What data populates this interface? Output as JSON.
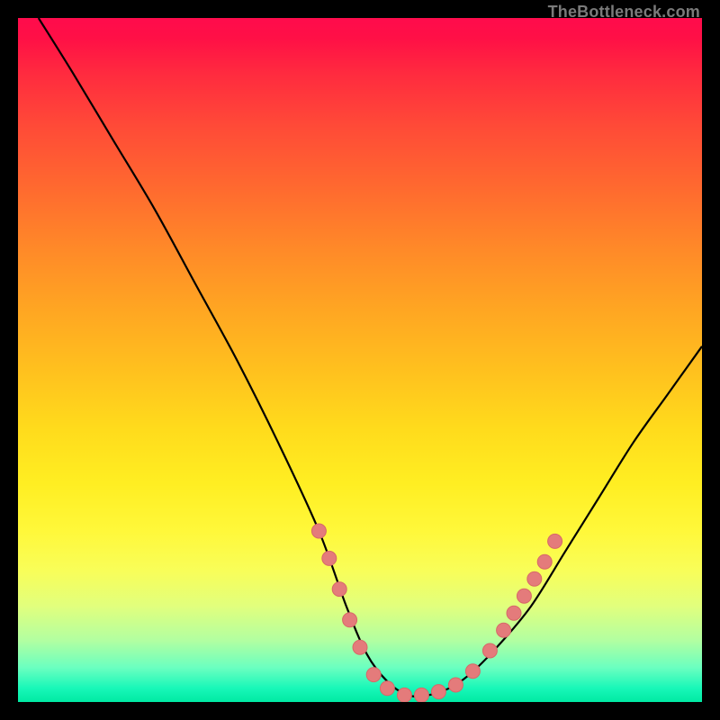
{
  "watermark": "TheBottleneck.com",
  "colors": {
    "frame": "#000000",
    "curve_stroke": "#000000",
    "marker_fill": "#e47b7b",
    "marker_stroke": "#d76868"
  },
  "chart_data": {
    "type": "line",
    "title": "",
    "xlabel": "",
    "ylabel": "",
    "xlim": [
      0,
      100
    ],
    "ylim": [
      0,
      100
    ],
    "grid": false,
    "series": [
      {
        "name": "curve",
        "x": [
          3,
          8,
          14,
          20,
          26,
          32,
          38,
          44,
          48,
          51,
          54,
          57,
          60,
          63,
          66,
          70,
          75,
          80,
          85,
          90,
          95,
          100
        ],
        "y": [
          100,
          92,
          82,
          72,
          61,
          50,
          38,
          25,
          14,
          7,
          3,
          1,
          1,
          2,
          4,
          8,
          14,
          22,
          30,
          38,
          45,
          52
        ]
      }
    ],
    "markers": [
      {
        "x": 44.0,
        "y": 25.0
      },
      {
        "x": 45.5,
        "y": 21.0
      },
      {
        "x": 47.0,
        "y": 16.5
      },
      {
        "x": 48.5,
        "y": 12.0
      },
      {
        "x": 50.0,
        "y": 8.0
      },
      {
        "x": 52.0,
        "y": 4.0
      },
      {
        "x": 54.0,
        "y": 2.0
      },
      {
        "x": 56.5,
        "y": 1.0
      },
      {
        "x": 59.0,
        "y": 1.0
      },
      {
        "x": 61.5,
        "y": 1.5
      },
      {
        "x": 64.0,
        "y": 2.5
      },
      {
        "x": 66.5,
        "y": 4.5
      },
      {
        "x": 69.0,
        "y": 7.5
      },
      {
        "x": 71.0,
        "y": 10.5
      },
      {
        "x": 72.5,
        "y": 13.0
      },
      {
        "x": 74.0,
        "y": 15.5
      },
      {
        "x": 75.5,
        "y": 18.0
      },
      {
        "x": 77.0,
        "y": 20.5
      },
      {
        "x": 78.5,
        "y": 23.5
      }
    ]
  }
}
